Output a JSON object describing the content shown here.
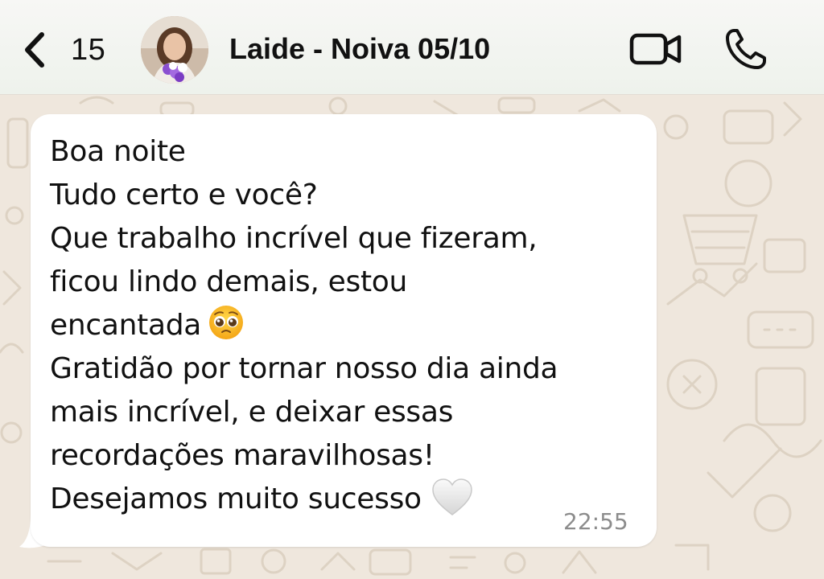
{
  "header": {
    "back_count": "15",
    "contact_name": "Laide - Noiva 05/10"
  },
  "icons": [
    "chevron-left-icon",
    "video-camera-icon",
    "phone-icon",
    "pleading-face-emoji",
    "white-heart-emoji"
  ],
  "colors": {
    "chat_background": "#efe7dd",
    "bubble": "#ffffff",
    "timestamp": "#8c8c8c"
  },
  "message": {
    "lines": [
      "Boa noite",
      "Tudo certo e você?",
      "Que trabalho incrível que fizeram,",
      "ficou lindo demais, estou",
      "encantada",
      "Gratidão por tornar nosso dia ainda",
      "mais incrível, e deixar essas",
      "recordações maravilhosas!",
      "Desejamos muito sucesso"
    ],
    "time": "22:55"
  }
}
